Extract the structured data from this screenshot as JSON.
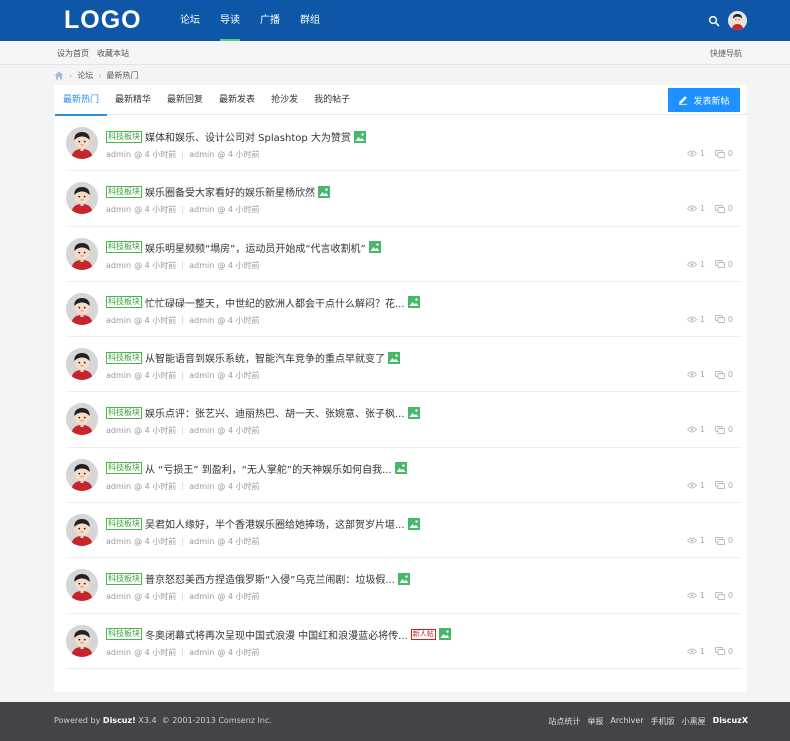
{
  "header": {
    "logo": "LOGO",
    "nav": [
      {
        "label": "论坛"
      },
      {
        "label": "导读"
      },
      {
        "label": "广播"
      },
      {
        "label": "群组"
      }
    ],
    "active_nav": 1,
    "icons": [
      "search-icon",
      "bell-icon",
      "user-avatar"
    ]
  },
  "subbar": {
    "left": [
      "设为首页",
      "收藏本站"
    ],
    "right": "快捷导航"
  },
  "breadcrumb": {
    "items": [
      "论坛",
      "最新热门"
    ]
  },
  "tabs": {
    "items": [
      "最新热门",
      "最新精华",
      "最新回复",
      "最新发表",
      "抢沙发",
      "我的帖子"
    ],
    "active": 0
  },
  "post_button": {
    "label": "发表新帖"
  },
  "threads": [
    {
      "tag": "科技板块",
      "title": "媒体和娱乐、设计公司对 Splashtop 大为赞赏",
      "author": "admin",
      "time": "@ 4 小时前",
      "last_author": "admin",
      "last_time": "@ 4 小时前",
      "views": "1",
      "replies": "0",
      "is_new": false
    },
    {
      "tag": "科技板块",
      "title": "娱乐圈备受大家看好的娱乐新星杨欣然",
      "author": "admin",
      "time": "@ 4 小时前",
      "last_author": "admin",
      "last_time": "@ 4 小时前",
      "views": "1",
      "replies": "0",
      "is_new": false
    },
    {
      "tag": "科技板块",
      "title": "娱乐明星频频“塌房”，运动员开始成“代言收割机”",
      "author": "admin",
      "time": "@ 4 小时前",
      "last_author": "admin",
      "last_time": "@ 4 小时前",
      "views": "1",
      "replies": "0",
      "is_new": false
    },
    {
      "tag": "科技板块",
      "title": "忙忙碌碌一整天，中世纪的欧洲人都会干点什么解闷？花...",
      "author": "admin",
      "time": "@ 4 小时前",
      "last_author": "admin",
      "last_time": "@ 4 小时前",
      "views": "1",
      "replies": "0",
      "is_new": false
    },
    {
      "tag": "科技板块",
      "title": "从智能语音到娱乐系统，智能汽车竞争的重点早就变了",
      "author": "admin",
      "time": "@ 4 小时前",
      "last_author": "admin",
      "last_time": "@ 4 小时前",
      "views": "1",
      "replies": "0",
      "is_new": false
    },
    {
      "tag": "科技板块",
      "title": "娱乐点评：张艺兴、迪丽热巴、胡一天、张婉意、张子枫...",
      "author": "admin",
      "time": "@ 4 小时前",
      "last_author": "admin",
      "last_time": "@ 4 小时前",
      "views": "1",
      "replies": "0",
      "is_new": false
    },
    {
      "tag": "科技板块",
      "title": "从 “亏损王” 到盈利，“无人掌舵”的天神娱乐如何自我...",
      "author": "admin",
      "time": "@ 4 小时前",
      "last_author": "admin",
      "last_time": "@ 4 小时前",
      "views": "1",
      "replies": "0",
      "is_new": false
    },
    {
      "tag": "科技板块",
      "title": "吴君如人缘好，半个香港娱乐圈给她捧场，这部贺岁片堪...",
      "author": "admin",
      "time": "@ 4 小时前",
      "last_author": "admin",
      "last_time": "@ 4 小时前",
      "views": "1",
      "replies": "0",
      "is_new": false
    },
    {
      "tag": "科技板块",
      "title": "普京怒怼美西方捏造俄罗斯“入侵”乌克兰闹剧：垃圾假...",
      "author": "admin",
      "time": "@ 4 小时前",
      "last_author": "admin",
      "last_time": "@ 4 小时前",
      "views": "1",
      "replies": "0",
      "is_new": false
    },
    {
      "tag": "科技板块",
      "title": "冬奥闭幕式将再次呈现中国式浪漫 中国红和浪漫蓝必将传...",
      "author": "admin",
      "time": "@ 4 小时前",
      "last_author": "admin",
      "last_time": "@ 4 小时前",
      "views": "1",
      "replies": "0",
      "is_new": true,
      "new_label": "新人帖"
    }
  ],
  "footer": {
    "powered": "Powered by",
    "brand": "Discuz!",
    "version": "X3.4",
    "copyright": "© 2001-2013 Comsenz Inc.",
    "links": [
      "站点统计",
      "举报",
      "Archiver",
      "手机版",
      "小黑屋"
    ],
    "brand_right": "DiscuzX"
  },
  "colors": {
    "header_bg": "#0e56a8",
    "nav_active_underline": "#4fd17b",
    "tab_active": "#2c8ce2",
    "post_button_bg": "#1e90ff",
    "tag_green": "#3aa23a",
    "image_icon_green": "#46b86a",
    "footer_bg": "#424448",
    "new_badge_red": "#d02020"
  }
}
